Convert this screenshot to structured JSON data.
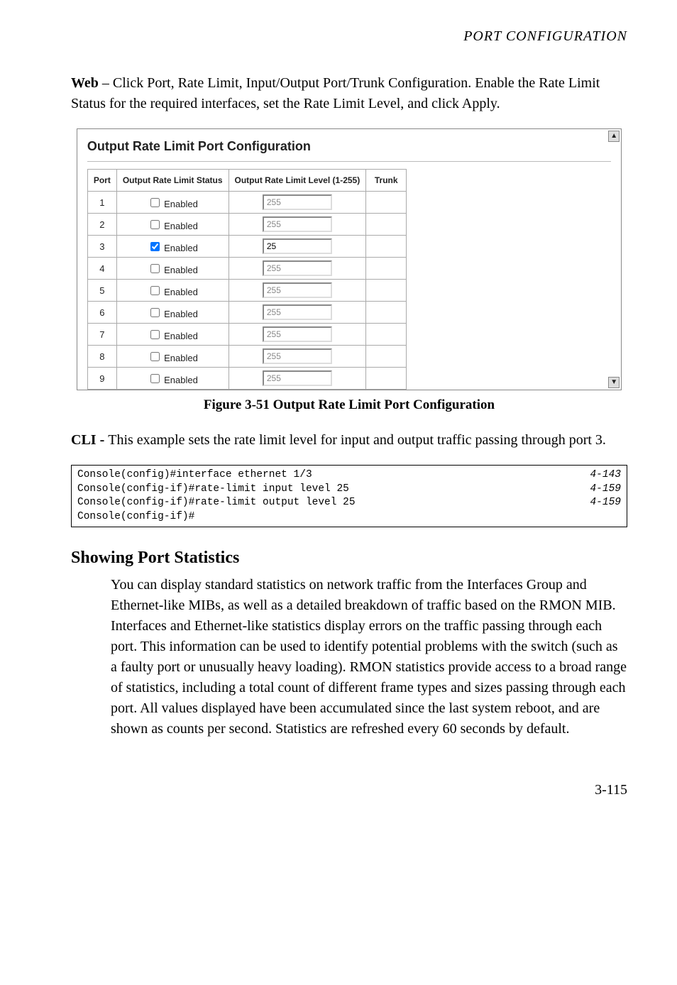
{
  "running_head": "PORT CONFIGURATION",
  "intro": {
    "bold": "Web",
    "rest": " – Click Port, Rate Limit, Input/Output Port/Trunk Configuration. Enable the Rate Limit Status for the required interfaces, set the Rate Limit Level, and click Apply."
  },
  "screenshot": {
    "title": "Output Rate Limit Port Configuration",
    "headers": [
      "Port",
      "Output Rate Limit Status",
      "Output Rate Limit Level (1-255)",
      "Trunk"
    ],
    "checkbox_label": "Enabled",
    "rows": [
      {
        "port": "1",
        "enabled": false,
        "level": "255",
        "trunk": ""
      },
      {
        "port": "2",
        "enabled": false,
        "level": "255",
        "trunk": ""
      },
      {
        "port": "3",
        "enabled": true,
        "level": "25",
        "trunk": ""
      },
      {
        "port": "4",
        "enabled": false,
        "level": "255",
        "trunk": ""
      },
      {
        "port": "5",
        "enabled": false,
        "level": "255",
        "trunk": ""
      },
      {
        "port": "6",
        "enabled": false,
        "level": "255",
        "trunk": ""
      },
      {
        "port": "7",
        "enabled": false,
        "level": "255",
        "trunk": ""
      },
      {
        "port": "8",
        "enabled": false,
        "level": "255",
        "trunk": ""
      },
      {
        "port": "9",
        "enabled": false,
        "level": "255",
        "trunk": ""
      }
    ]
  },
  "figure_caption": "Figure 3-51  Output Rate Limit Port Configuration",
  "cli_intro": {
    "bold": "CLI - ",
    "rest": "This example sets the rate limit level for input and output traffic passing through port 3."
  },
  "code": {
    "left": "Console(config)#interface ethernet 1/3\nConsole(config-if)#rate-limit input level 25\nConsole(config-if)#rate-limit output level 25\nConsole(config-if)#",
    "right": "4-143\n4-159\n4-159\n "
  },
  "section_heading": "Showing Port Statistics",
  "section_body": "You can display standard statistics on network traffic from the Interfaces Group and Ethernet-like MIBs, as well as a detailed breakdown of traffic based on the RMON MIB. Interfaces and Ethernet-like statistics display errors on the traffic passing through each port. This information can be used to identify potential problems with the switch (such as a faulty port or unusually heavy loading). RMON statistics provide access to a broad range of statistics, including a total count of different frame types and sizes passing through each port. All values displayed have been accumulated since the last system reboot, and are shown as counts per second. Statistics are refreshed every 60 seconds by default.",
  "page_number": "3-115"
}
